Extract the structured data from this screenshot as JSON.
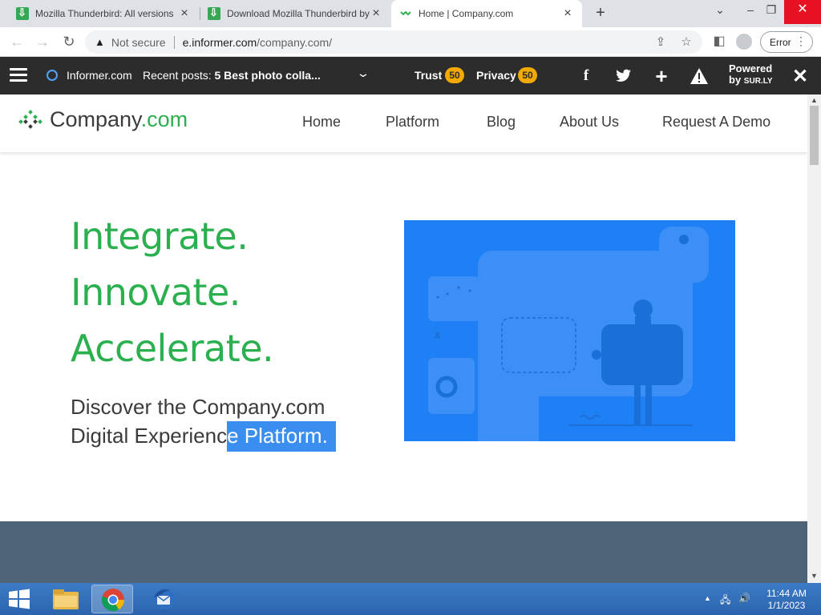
{
  "browser": {
    "tabs": [
      {
        "title": "Mozilla Thunderbird: All versions",
        "active": false
      },
      {
        "title": "Download Mozilla Thunderbird by",
        "active": false
      },
      {
        "title": "Home | Company.com",
        "active": true
      }
    ],
    "security_label": "Not secure",
    "url_main": "e.informer.com",
    "url_path": "/company.com/",
    "error_label": "Error"
  },
  "informer_bar": {
    "site": "Informer.com",
    "recent_label": "Recent posts:",
    "recent_post": "5 Best photo colla...",
    "trust_label": "Trust",
    "trust_score": "50",
    "privacy_label": "Privacy",
    "privacy_score": "50",
    "powered_line1": "Powered",
    "powered_by": "by",
    "powered_brand": "SUR.LY"
  },
  "site": {
    "brand_name": "Company",
    "brand_suffix": ".com",
    "nav": [
      "Home",
      "Platform",
      "Blog",
      "About Us",
      "Request A Demo"
    ],
    "hero_lines": [
      "Integrate.",
      "Innovate.",
      "Accelerate."
    ],
    "sub_line1": "Discover the Company.com",
    "sub_line2_plain": "Digital Experienc",
    "sub_line2_highlight": "e Platform.",
    "colors": {
      "green": "#2bb04f",
      "hero_blue": "#1f80f5",
      "band": "#4d6478"
    }
  },
  "taskbar": {
    "time": "11:44 AM",
    "date": "1/1/2023"
  }
}
